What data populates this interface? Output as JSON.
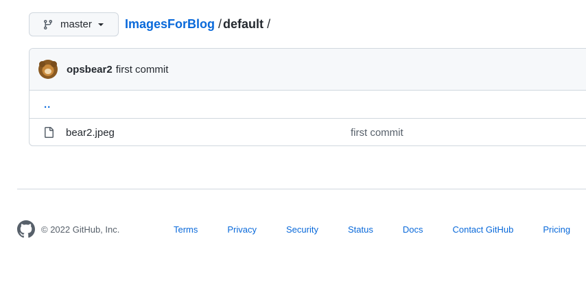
{
  "branch": {
    "name": "master",
    "icon": "git-branch-icon"
  },
  "breadcrumb": {
    "repo": "ImagesForBlog",
    "separator1": "/",
    "dir": "default",
    "separator2": "/"
  },
  "commit": {
    "author": "opsbear2",
    "message": "first commit"
  },
  "listing": {
    "parent_link": "..",
    "files": [
      {
        "name": "bear2.jpeg",
        "commit_message": "first commit",
        "icon": "file-icon"
      }
    ]
  },
  "footer": {
    "copyright": "© 2022 GitHub, Inc.",
    "links": [
      "Terms",
      "Privacy",
      "Security",
      "Status",
      "Docs",
      "Contact GitHub",
      "Pricing"
    ]
  },
  "colors": {
    "link": "#0969da",
    "border": "#d0d7de",
    "header_bg": "#f6f8fa",
    "muted": "#57606a"
  }
}
